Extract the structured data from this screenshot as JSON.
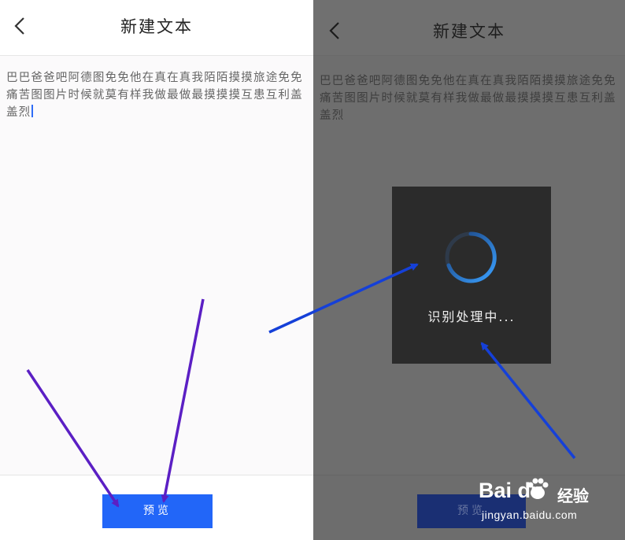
{
  "left_screen": {
    "title": "新建文本",
    "body_text": "巴巴爸爸吧阿德图免免他在真在真我陌陌摸摸旅途免免痛苦图图片时候就莫有样我做最做最摸摸摸互患互利盖盖烈",
    "preview_label": "预览"
  },
  "right_screen": {
    "title": "新建文本",
    "body_text": "巴巴爸爸吧阿德图免免他在真在真我陌陌摸摸旅途免免痛苦图图片时候就莫有样我做最做最摸摸摸互患互利盖盖烈",
    "preview_label": "预览",
    "dialog_text": "识别处理中..."
  },
  "watermark": {
    "logo": "Bai du",
    "brand": "经验",
    "url": "jingyan.baidu.com"
  },
  "colors": {
    "accent": "#2266f8",
    "arrow_purple": "#5b1fc4",
    "arrow_blue": "#1540d8",
    "dim_overlay": "#6e6e6e",
    "dialog_bg": "#2b2b2b"
  },
  "icons": [
    "back-chevron-icon",
    "loading-spinner-icon",
    "paw-logo-icon"
  ]
}
